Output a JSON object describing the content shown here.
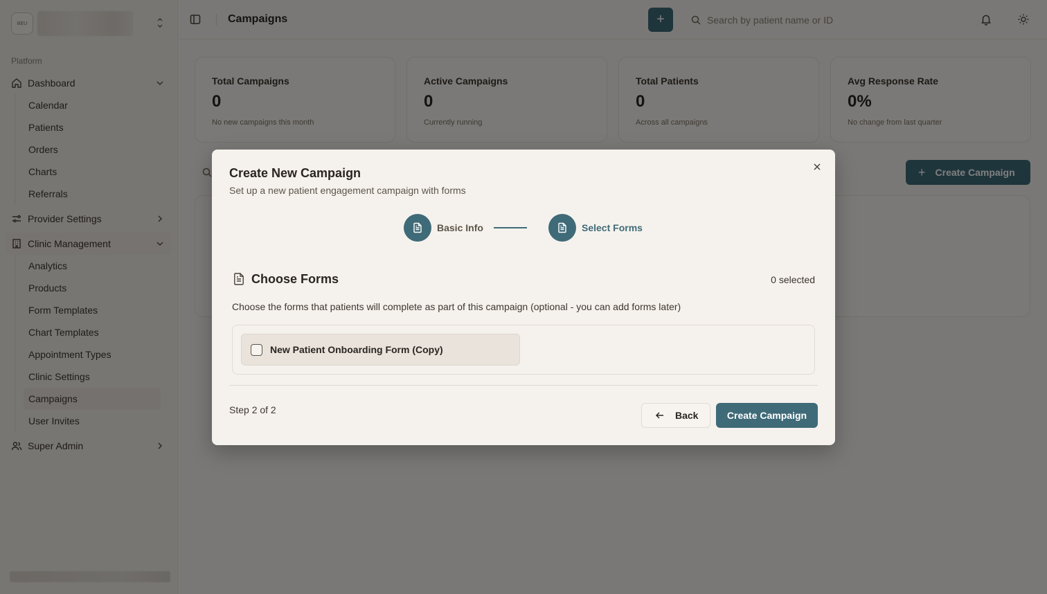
{
  "sidebar": {
    "brand_logo_text": "BEU",
    "section_label": "Platform",
    "dashboard": {
      "label": "Dashboard",
      "items": [
        "Calendar",
        "Patients",
        "Orders",
        "Charts",
        "Referrals"
      ]
    },
    "provider_settings": {
      "label": "Provider Settings"
    },
    "clinic_management": {
      "label": "Clinic Management",
      "items": [
        "Analytics",
        "Products",
        "Form Templates",
        "Chart Templates",
        "Appointment Types",
        "Clinic Settings",
        "Campaigns",
        "User Invites"
      ],
      "active": "Campaigns"
    },
    "super_admin": {
      "label": "Super Admin"
    }
  },
  "header": {
    "title": "Campaigns",
    "plus_label": "+",
    "search_placeholder": "Search by patient name or ID"
  },
  "stats": [
    {
      "label": "Total Campaigns",
      "value": "0",
      "sub": "No new campaigns this month"
    },
    {
      "label": "Active Campaigns",
      "value": "0",
      "sub": "Currently running"
    },
    {
      "label": "Total Patients",
      "value": "0",
      "sub": "Across all campaigns"
    },
    {
      "label": "Avg Response Rate",
      "value": "0%",
      "sub": "No change from last quarter"
    }
  ],
  "main": {
    "create_label": "Create Campaign",
    "create_plus": "+"
  },
  "modal": {
    "title": "Create New Campaign",
    "description": "Set up a new patient engagement campaign with forms",
    "steps": [
      {
        "label": "Basic Info"
      },
      {
        "label": "Select Forms"
      }
    ],
    "section_title": "Choose Forms",
    "selected_count": "0 selected",
    "section_desc": "Choose the forms that patients will complete as part of this campaign (optional - you can add forms later)",
    "forms": [
      {
        "name": "New Patient Onboarding Form (Copy)",
        "checked": false
      }
    ],
    "step_indicator": "Step 2 of 2",
    "back_label": "Back",
    "create_label": "Create Campaign"
  },
  "colors": {
    "accent": "#3f6a78",
    "background": "#f4f1ec",
    "overlay": "rgba(0,0,0,0.5)"
  }
}
